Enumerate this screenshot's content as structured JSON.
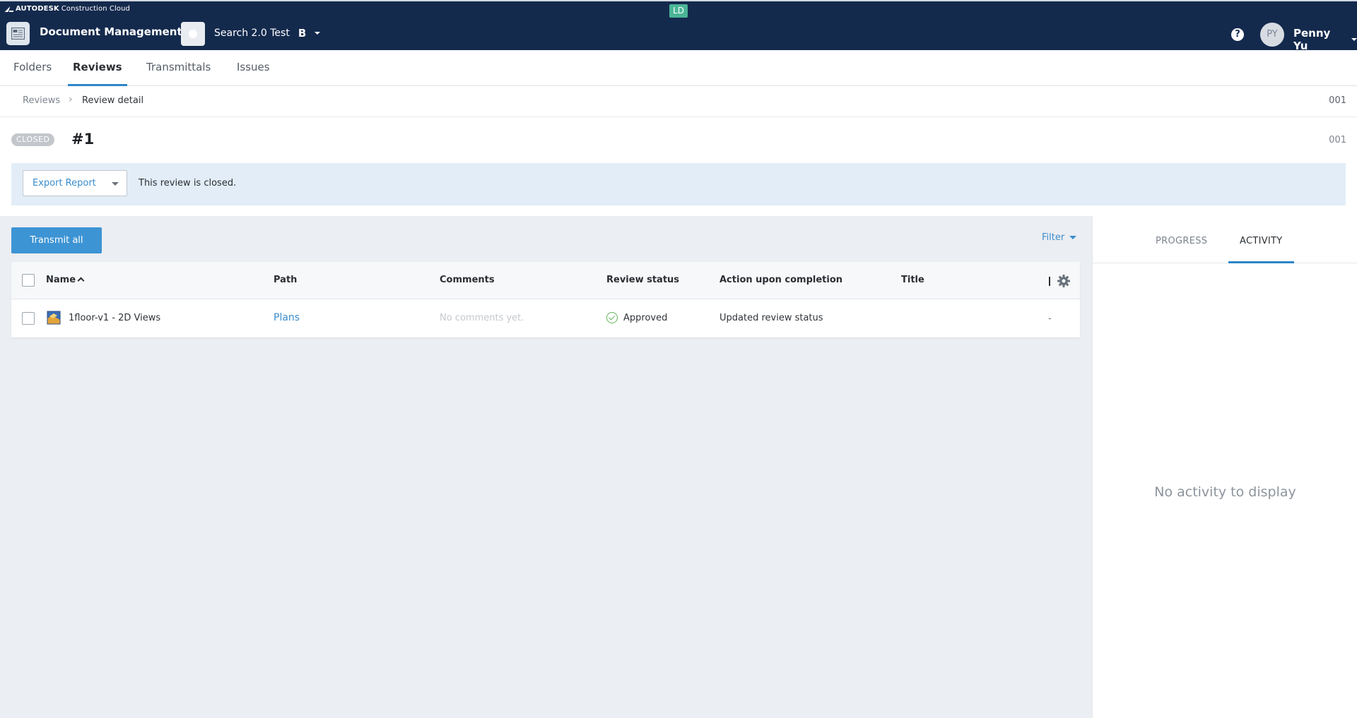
{
  "header": {
    "brand_bold": "AUTODESK",
    "brand_rest": "Construction Cloud",
    "env_badge": "LD",
    "module_title": "Document Management",
    "project_name": "Search 2.0 Test",
    "project_mark": "B",
    "user_initials": "PY",
    "user_name": "Penny Yu",
    "help_glyph": "?"
  },
  "tabs": [
    {
      "label": "Folders",
      "active": false
    },
    {
      "label": "Reviews",
      "active": true
    },
    {
      "label": "Transmittals",
      "active": false
    },
    {
      "label": "Issues",
      "active": false
    }
  ],
  "breadcrumb": {
    "root": "Reviews",
    "separator": "›",
    "current": "Review detail",
    "code": "001"
  },
  "review": {
    "status": "CLOSED",
    "number": "#1",
    "code": "001",
    "banner_text": "This review is closed.",
    "export_label": "Export Report"
  },
  "toolbar": {
    "transmit_label": "Transmit all",
    "filter_label": "Filter"
  },
  "table": {
    "columns": [
      "Name",
      "Path",
      "Comments",
      "Review status",
      "Action upon completion",
      "Title"
    ],
    "rows": [
      {
        "name": "1floor-v1 - 2D Views",
        "path": "Plans",
        "comments": "No comments yet.",
        "review_status": "Approved",
        "action": "Updated review status",
        "title": "",
        "extra": "-"
      }
    ]
  },
  "side_panel": {
    "tabs": [
      "PROGRESS",
      "ACTIVITY"
    ],
    "active_tab": "ACTIVITY",
    "empty_message": "No activity to display"
  },
  "colors": {
    "header_bg": "#142a4d",
    "accent_blue": "#3d94d4",
    "active_tab_underline": "#2d86c8",
    "banner_bg": "#e2edf7",
    "approved_green": "#65b35a",
    "env_badge": "#4bb596"
  },
  "icons": [
    "autodesk-logo-icon",
    "document-management-icon",
    "help-icon",
    "sort-ascending-icon",
    "settings-gear-icon",
    "drawing-file-icon",
    "approved-check-icon",
    "chevron-right-icon"
  ]
}
